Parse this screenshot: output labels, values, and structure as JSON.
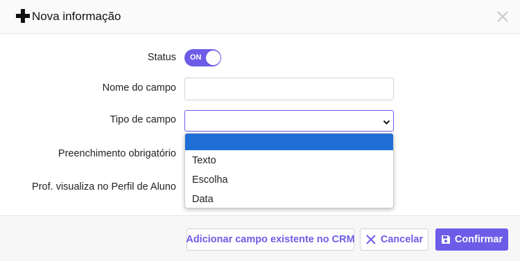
{
  "header": {
    "title": "Nova informação",
    "plus_icon": "plus-icon",
    "close_icon": "close-icon"
  },
  "form": {
    "status_label": "Status",
    "status_toggle": {
      "text": "ON",
      "checked": true,
      "color": "#6c5ce7"
    },
    "field_name_label": "Nome do campo",
    "field_name_value": "",
    "field_type_label": "Tipo de campo",
    "field_type_value": "",
    "field_type_options": [
      "",
      "Texto",
      "Escolha",
      "Data"
    ],
    "required_label": "Preenchimento obrigatório",
    "profile_label": "Prof. visualiza no Perfil de Aluno"
  },
  "footer": {
    "add_existing_label": "Adicionar campo existente no CRM",
    "cancel_label": "Cancelar",
    "confirm_label": "Confirmar"
  },
  "colors": {
    "accent": "#6c5ce7",
    "selected_option": "#1f6ed6"
  }
}
